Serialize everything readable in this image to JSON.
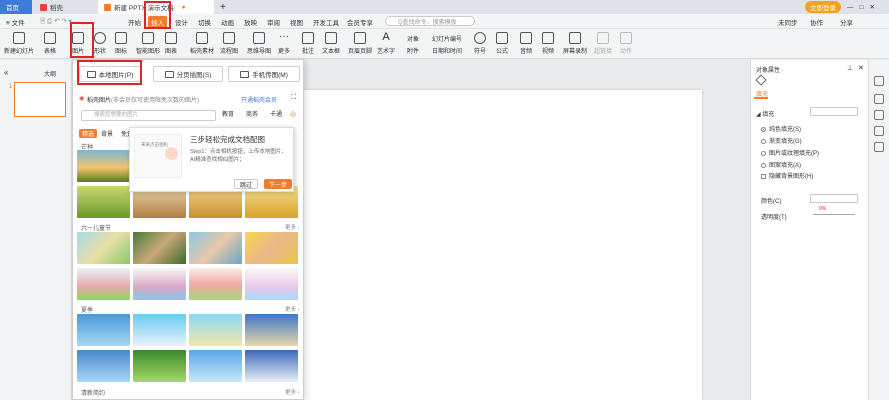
{
  "titlebar": {
    "home_tab": "首页",
    "doc_tab": "稻壳",
    "ppt_tab": "新建 PPTX 演示文稿",
    "add_tab": "+",
    "login": "立即登录",
    "win_min": "—",
    "win_max": "□",
    "win_close": "✕"
  },
  "menubar": {
    "file": "≡ 文件",
    "items": [
      "开始",
      "插入",
      "设计",
      "切换",
      "动画",
      "放映",
      "审阅",
      "视图",
      "开发工具",
      "会员专享"
    ],
    "search_placeholder": "Q查找命令、搜索模板",
    "unsynced": "未同步",
    "collab": "协作",
    "share": "分享"
  },
  "ribbon": {
    "new_slide": "新建幻灯片",
    "table": "表格",
    "picture": "图片",
    "shape": "形状",
    "icon": "图标",
    "smartart": "智能图形",
    "chart": "图表",
    "stock": "稻壳素材",
    "flowchart": "流程图",
    "mindmap": "思维导图",
    "more": "更多",
    "comment": "批注",
    "textbox": "文本框",
    "header_footer": "页眉页脚",
    "wordart": "艺术字",
    "object": "对象",
    "slide_number": "幻灯片编号",
    "attachment": "附件",
    "datetime": "日期和时间",
    "symbol": "符号",
    "formula": "公式",
    "audio": "音频",
    "video": "视频",
    "screen_record": "屏幕录制",
    "hyperlink": "超链接",
    "action": "动作"
  },
  "leftpanel": {
    "collapse": "«",
    "outline_tab": "大纲",
    "slide_tab": "幻灯片",
    "slide_number": "1"
  },
  "dropdown": {
    "local_picture": "本地图片(P)",
    "split_picture": "分页插图(S)",
    "phone_picture": "手机传图(M)",
    "stock_title": "稻壳图片",
    "stock_note": "(非会员仅可使用限免次数的图片)",
    "vip": "开通稻壳会员",
    "search_placeholder": "搜索您想要的图片",
    "tag_edu": "教育",
    "tag_biz": "商务",
    "tag_cartoon": "卡通",
    "categories": [
      "精选",
      "背景",
      "免费"
    ],
    "sections": [
      "芒种",
      "六一儿童节",
      "夏季",
      "清新简约"
    ],
    "more": "更多 ›"
  },
  "tip": {
    "title": "三步轻松完成文档配图",
    "body": "Step1：点击相机按钮，上传本地图片，AI精准查找相似图片；",
    "skip": "跳过",
    "next": "下一步",
    "preview_text": "来来点击相机",
    "close": "×"
  },
  "rightpanel": {
    "title": "对象属性 ·",
    "tab_fill": "填充",
    "section_fill": "◢ 填充",
    "options": [
      "纯色填充(S)",
      "渐变填充(G)",
      "图片或纹理填充(P)",
      "图案填充(A)"
    ],
    "hide_bg": "隐藏背景图形(H)",
    "color_label": "颜色(C)",
    "transparency_label": "透明度(T)",
    "transparency_value": "0%"
  },
  "colors": {
    "accent": "#f47a2c",
    "home_tab": "#3e7bd8",
    "highlight": "#e32222"
  }
}
